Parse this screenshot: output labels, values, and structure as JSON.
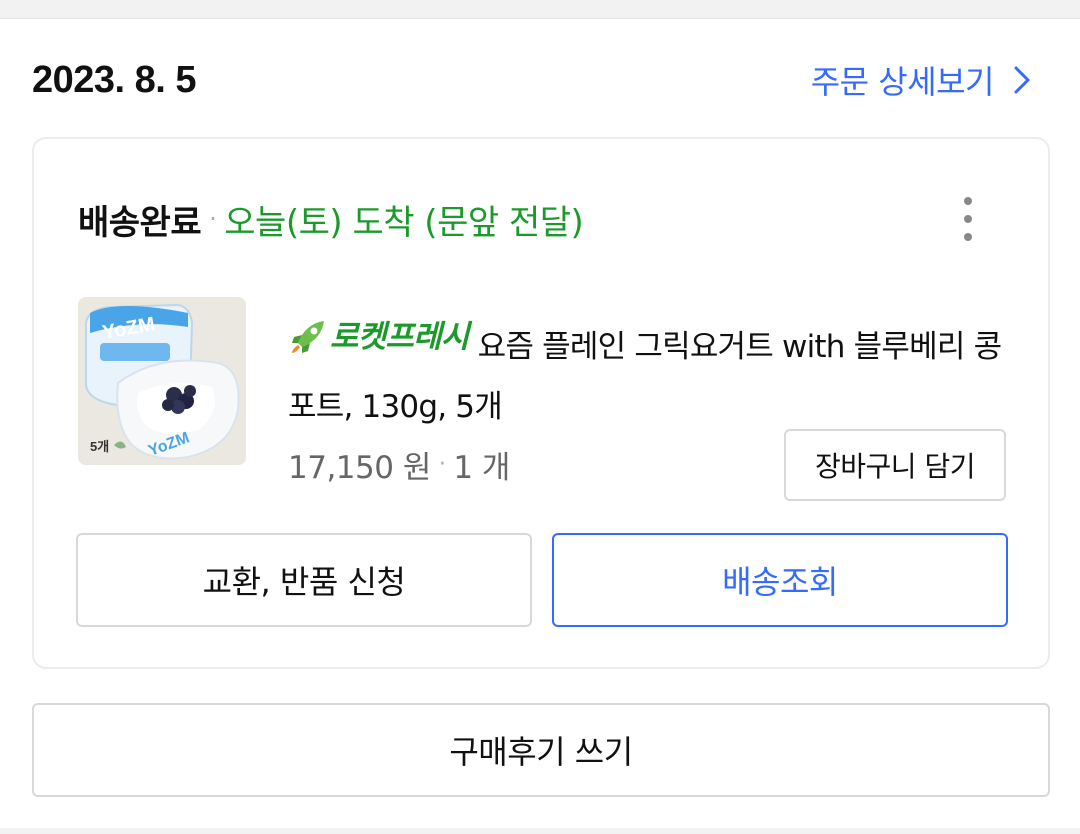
{
  "order": {
    "date": "2023. 8. 5",
    "detail_link_label": "주문 상세보기"
  },
  "shipment": {
    "status": "배송완료",
    "separator": "·",
    "arrival": "오늘(토) 도착 (문앞 전달)"
  },
  "product": {
    "badge": "로켓프레시",
    "name": "요즘 플레인 그릭요거트 with 블루베리 콩포트, 130g, 5개",
    "price": "17,150 원",
    "separator": "·",
    "quantity": "1 개",
    "thumbnail": {
      "brand_text": "YoZM",
      "count_tag": "5개"
    }
  },
  "buttons": {
    "add_to_cart": "장바구니 담기",
    "exchange_return": "교환, 반품 신청",
    "track_delivery": "배송조회",
    "write_review": "구매후기 쓰기"
  },
  "icons": {
    "more": "more-vertical-icon",
    "chevron": "chevron-right-icon",
    "rocket": "rocket-icon"
  },
  "colors": {
    "accent_blue": "#346aff",
    "status_green": "#1b9a2b",
    "border_gray": "#d8d8d8"
  }
}
